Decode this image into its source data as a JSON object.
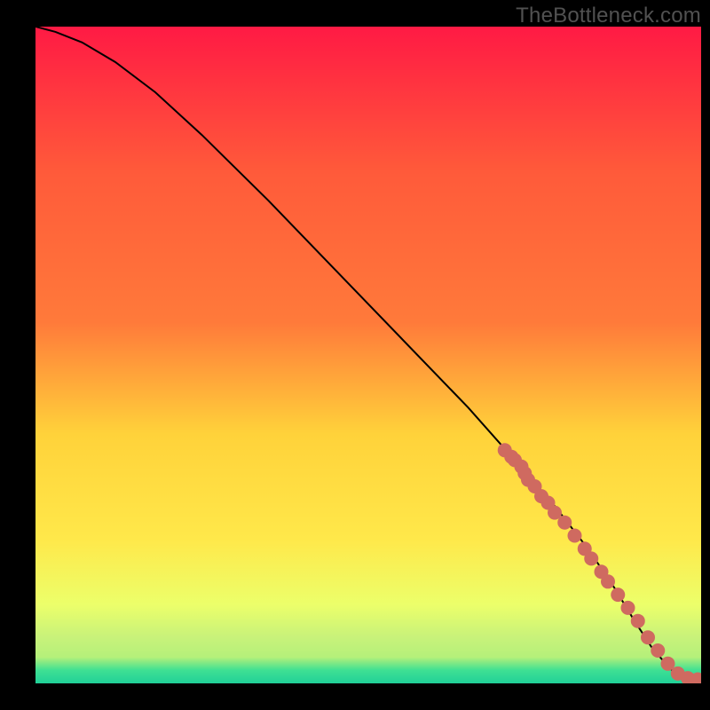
{
  "watermark": "TheBottleneck.com",
  "colors": {
    "frame": "#000000",
    "gradient_top": "#ff1a44",
    "gradient_mid_upper": "#ff7a3a",
    "gradient_mid": "#ffd23a",
    "gradient_mid_lower": "#ffe84a",
    "gradient_lower": "#ecff6a",
    "gradient_green1": "#b5f07a",
    "gradient_green2": "#3fe093",
    "curve": "#000000",
    "points": "#cf6a60",
    "watermark_text": "#515151"
  },
  "chart_data": {
    "type": "line",
    "title": "",
    "xlabel": "",
    "ylabel": "",
    "xlim": [
      0,
      100
    ],
    "ylim": [
      0,
      100
    ],
    "curve": {
      "x": [
        0,
        3,
        7,
        12,
        18,
        25,
        35,
        45,
        55,
        65,
        72,
        78,
        83,
        87,
        90,
        92.5,
        94.5,
        96,
        97.5,
        100
      ],
      "y": [
        100,
        99.2,
        97.6,
        94.6,
        90,
        83.5,
        73.5,
        63,
        52.5,
        42,
        34,
        27,
        20.5,
        14.5,
        9.5,
        5.6,
        3.2,
        1.6,
        0.7,
        0.5
      ]
    },
    "series": [
      {
        "name": "highlighted-points",
        "x": [
          70.5,
          71.5,
          72,
          73,
          73.5,
          74,
          75,
          76,
          77,
          78,
          79.5,
          81,
          82.5,
          83.5,
          85,
          86,
          87.5,
          89,
          90.5,
          92,
          93.5,
          95,
          96.5,
          98,
          99.5
        ],
        "y": [
          35.5,
          34.5,
          34,
          33,
          32,
          31,
          30,
          28.5,
          27.5,
          26,
          24.5,
          22.5,
          20.5,
          19,
          17,
          15.5,
          13.5,
          11.5,
          9.5,
          7,
          5,
          3,
          1.5,
          0.8,
          0.6
        ]
      }
    ]
  }
}
